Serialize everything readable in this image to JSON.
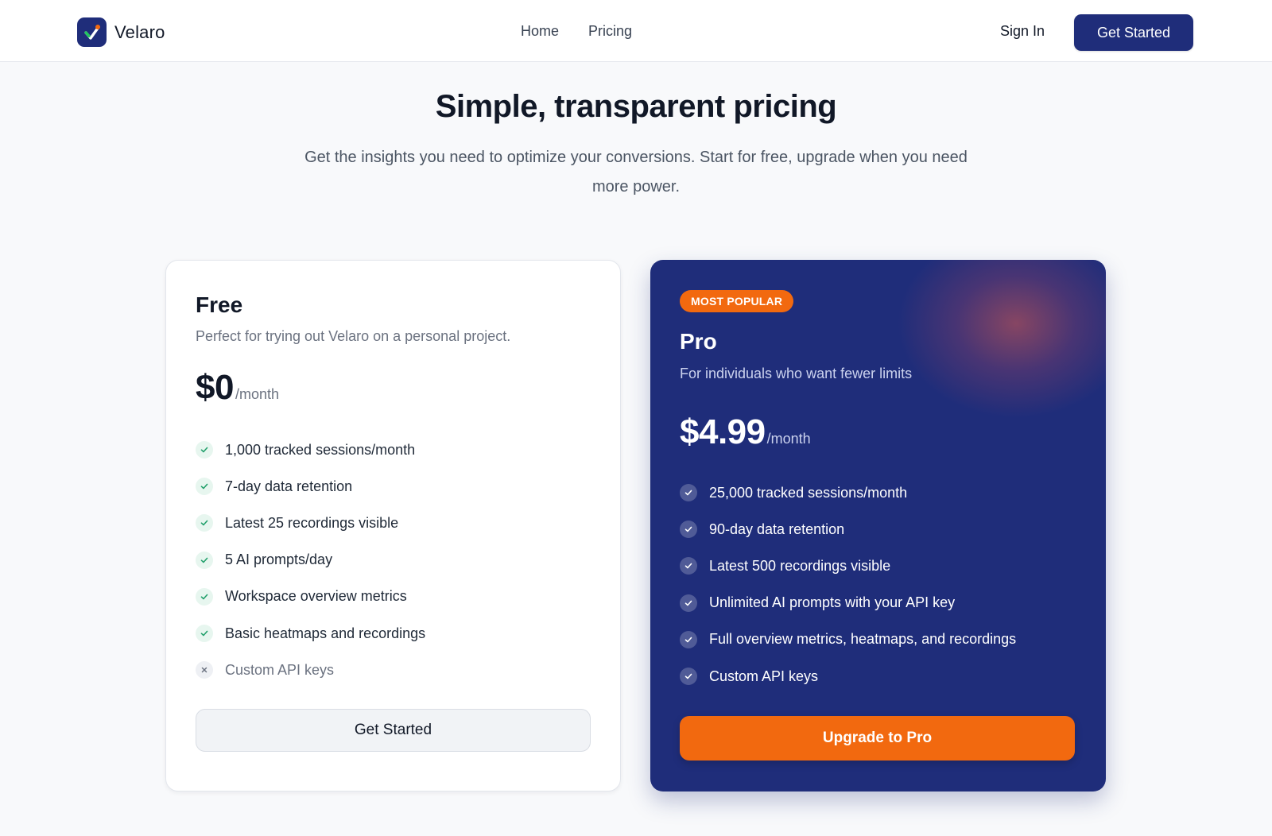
{
  "header": {
    "brand": "Velaro",
    "nav": [
      {
        "label": "Home"
      },
      {
        "label": "Pricing"
      }
    ],
    "sign_in": "Sign In",
    "get_started": "Get Started"
  },
  "hero": {
    "title": "Simple, transparent pricing",
    "subtitle": "Get the insights you need to optimize your conversions. Start for free, upgrade when you need more power."
  },
  "plans": {
    "free": {
      "name": "Free",
      "description": "Perfect for trying out Velaro on a personal project.",
      "price": "$0",
      "period": "/month",
      "features": [
        {
          "label": "1,000 tracked sessions/month",
          "icon": "check-icon"
        },
        {
          "label": "7-day data retention",
          "icon": "check-icon"
        },
        {
          "label": "Latest 25 recordings visible",
          "icon": "check-icon"
        },
        {
          "label": "5 AI prompts/day",
          "icon": "check-icon"
        },
        {
          "label": "Workspace overview metrics",
          "icon": "check-icon"
        },
        {
          "label": "Basic heatmaps and recordings",
          "icon": "check-icon"
        },
        {
          "label": "Custom API keys",
          "icon": "x-icon"
        }
      ],
      "button": "Get Started"
    },
    "pro": {
      "badge": "MOST POPULAR",
      "name": "Pro",
      "description": "For individuals who want fewer limits",
      "price": "$4.99",
      "period": "/month",
      "features": [
        {
          "label": "25,000 tracked sessions/month",
          "icon": "check-icon"
        },
        {
          "label": "90-day data retention",
          "icon": "check-icon"
        },
        {
          "label": "Latest 500 recordings visible",
          "icon": "check-icon"
        },
        {
          "label": "Unlimited AI prompts with your API key",
          "icon": "check-icon"
        },
        {
          "label": "Full overview metrics, heatmaps, and recordings",
          "icon": "check-icon"
        },
        {
          "label": "Custom API keys",
          "icon": "check-icon"
        }
      ],
      "button": "Upgrade to Pro"
    }
  },
  "colors": {
    "brand": "#1f2d7a",
    "accent": "#f2690f",
    "check_green": "#22a06b"
  }
}
